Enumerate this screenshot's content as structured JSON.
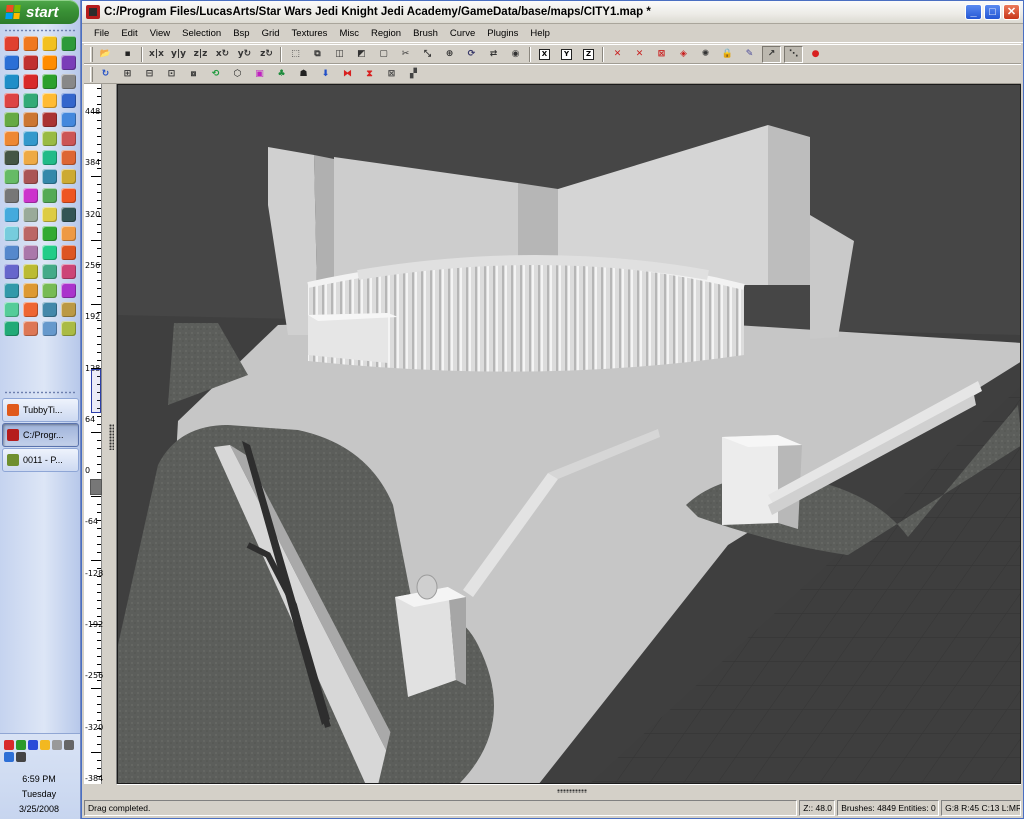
{
  "taskbar": {
    "start_label": "start",
    "quicklaunch_colors": [
      "#e04030",
      "#f07820",
      "#f2c020",
      "#2d9a3a",
      "#2a6fd6",
      "#c03030",
      "#ff8c00",
      "#7a3db8",
      "#1f8ec8",
      "#d82a2a",
      "#2ca02c",
      "#888888",
      "#d44",
      "#3a7",
      "#fb3",
      "#36c",
      "#6a4",
      "#c73",
      "#a33",
      "#48d",
      "#e83",
      "#39c",
      "#9b4",
      "#c55",
      "#454",
      "#ea4",
      "#2b8",
      "#d63",
      "#6b6",
      "#a55",
      "#38a",
      "#ca3",
      "#777",
      "#c3c",
      "#5a5",
      "#e52",
      "#4ad",
      "#9a9",
      "#dc4",
      "#355",
      "#7cd",
      "#b66",
      "#3a3",
      "#e94",
      "#58c",
      "#a7a",
      "#2c8",
      "#d52",
      "#66c",
      "#bb3",
      "#4a8",
      "#c47",
      "#39a",
      "#d93",
      "#7b5",
      "#a3c",
      "#5c9",
      "#e63",
      "#48a",
      "#b94",
      "#2a7",
      "#d75",
      "#69c",
      "#ab4"
    ],
    "tasks": [
      {
        "label": "TubbyTi...",
        "icon_color": "#e05a1c",
        "active": false
      },
      {
        "label": "C:/Progr...",
        "icon_color": "#b51c1c",
        "active": true
      },
      {
        "label": "0011 - P...",
        "icon_color": "#6f8f2f",
        "active": false
      }
    ],
    "tray_icon_colors": [
      "#d82a2a",
      "#2a9a2a",
      "#2a4ad8",
      "#f2b820",
      "#999999",
      "#666666",
      "#2d6fd6",
      "#444444"
    ],
    "clock": {
      "time": "6:59 PM",
      "day": "Tuesday",
      "date": "3/25/2008"
    }
  },
  "window": {
    "title": "C:/Program Files/LucasArts/Star Wars Jedi Knight Jedi Academy/GameData/base/maps/CITY1.map *",
    "caption_buttons": {
      "minimize": "_",
      "maximize": "□",
      "close": "✕"
    }
  },
  "menu": [
    {
      "label": "File"
    },
    {
      "label": "Edit"
    },
    {
      "label": "View"
    },
    {
      "label": "Selection"
    },
    {
      "label": "Bsp"
    },
    {
      "label": "Grid"
    },
    {
      "label": "Textures"
    },
    {
      "label": "Misc"
    },
    {
      "label": "Region"
    },
    {
      "label": "Brush"
    },
    {
      "label": "Curve"
    },
    {
      "label": "Plugins"
    },
    {
      "label": "Help"
    }
  ],
  "toolbar1": [
    {
      "name": "open-icon",
      "glyph": "📂",
      "color": "#c8961e"
    },
    {
      "name": "save-icon",
      "glyph": "▪",
      "color": "#222"
    },
    {
      "sep": true
    },
    {
      "name": "flip-x-icon",
      "glyph": "x|x",
      "color": "#333"
    },
    {
      "name": "flip-y-icon",
      "glyph": "y|y",
      "color": "#333"
    },
    {
      "name": "flip-z-icon",
      "glyph": "z|z",
      "color": "#333"
    },
    {
      "name": "rotate-x-icon",
      "glyph": "x↻",
      "color": "#333"
    },
    {
      "name": "rotate-y-icon",
      "glyph": "y↻",
      "color": "#333"
    },
    {
      "name": "rotate-z-icon",
      "glyph": "z↻",
      "color": "#333"
    },
    {
      "sep": true
    },
    {
      "name": "select-touching-icon",
      "glyph": "⬚",
      "color": "#333"
    },
    {
      "name": "select-inside-icon",
      "glyph": "⧉",
      "color": "#333"
    },
    {
      "name": "csg-subtract-icon",
      "glyph": "◫",
      "color": "#333"
    },
    {
      "name": "csg-merge-icon",
      "glyph": "◩",
      "color": "#333"
    },
    {
      "name": "hollow-icon",
      "glyph": "▢",
      "color": "#333"
    },
    {
      "name": "clipper-icon",
      "glyph": "✂",
      "color": "#333"
    },
    {
      "name": "scale-icon",
      "glyph": "⤡",
      "color": "#333"
    },
    {
      "name": "snap-icon",
      "glyph": "⊕",
      "color": "#333"
    },
    {
      "name": "rotate-tool-icon",
      "glyph": "⟳",
      "color": "#336"
    },
    {
      "name": "change-views-icon",
      "glyph": "⇄",
      "color": "#333"
    },
    {
      "name": "camera-icon",
      "glyph": "◉",
      "color": "#333"
    },
    {
      "sep": true
    },
    {
      "name": "view-x-icon",
      "glyph": "X",
      "color": "#000",
      "boxed": true
    },
    {
      "name": "view-y-icon",
      "glyph": "Y",
      "color": "#000",
      "boxed": true
    },
    {
      "name": "view-z-icon",
      "glyph": "Z",
      "color": "#000",
      "boxed": true
    },
    {
      "sep": true
    },
    {
      "name": "filter-patches-icon",
      "glyph": "✕",
      "color": "#c81e1e"
    },
    {
      "name": "filter-entities-icon",
      "glyph": "✕",
      "color": "#c81e1e"
    },
    {
      "name": "filter-clip-icon",
      "glyph": "⊠",
      "color": "#c81e1e"
    },
    {
      "name": "filter-caulk-icon",
      "glyph": "◈",
      "color": "#c81e1e"
    },
    {
      "name": "lighting-icon",
      "glyph": "✺",
      "color": "#333"
    },
    {
      "name": "texture-lock-icon",
      "glyph": "🔒",
      "color": "#333"
    },
    {
      "name": "patch-tool-icon",
      "glyph": "✎",
      "color": "#4a4a9a"
    },
    {
      "name": "vertex-edit-icon",
      "glyph": "↗",
      "color": "#333",
      "pressed": true
    },
    {
      "name": "edge-edit-icon",
      "glyph": "⋱",
      "color": "#333",
      "pressed": true
    },
    {
      "name": "plugin-icon",
      "glyph": "●",
      "color": "#d82020"
    }
  ],
  "toolbar2": [
    {
      "name": "curve-tool-icon",
      "glyph": "↻",
      "color": "#2250c8"
    },
    {
      "name": "patch-cylinder-icon",
      "glyph": "⊞",
      "color": "#333"
    },
    {
      "name": "patch-dense-icon",
      "glyph": "⊟",
      "color": "#333"
    },
    {
      "name": "patch-bevel-icon",
      "glyph": "⊡",
      "color": "#333"
    },
    {
      "name": "patch-cone-icon",
      "glyph": "⧈",
      "color": "#333"
    },
    {
      "name": "patch-rotate-icon",
      "glyph": "⟲",
      "color": "#1a9a3a"
    },
    {
      "name": "patch-hexagon-icon",
      "glyph": "⬡",
      "color": "#222"
    },
    {
      "name": "patch-texture-icon",
      "glyph": "▣",
      "color": "#c020c0"
    },
    {
      "name": "patch-thicken-icon",
      "glyph": "♣",
      "color": "#1a8a3a"
    },
    {
      "name": "patch-cap-icon",
      "glyph": "☗",
      "color": "#222"
    },
    {
      "name": "patch-invert-icon",
      "glyph": "⬇",
      "color": "#2250c8"
    },
    {
      "name": "patch-mirror-icon",
      "glyph": "⧓",
      "color": "#d82020"
    },
    {
      "name": "patch-split-icon",
      "glyph": "⧗",
      "color": "#d82020"
    },
    {
      "name": "patch-matrix-icon",
      "glyph": "⊠",
      "color": "#444"
    },
    {
      "name": "patch-weld-icon",
      "glyph": "▞",
      "color": "#444"
    }
  ],
  "zruler": {
    "labels": [
      "448",
      "384",
      "320",
      "256",
      "192",
      "128",
      "64",
      "0",
      "-64",
      "-128",
      "-192",
      "-256",
      "-320",
      "-384"
    ]
  },
  "statusbar": {
    "message": "Drag completed.",
    "z": "Z:: 48.0",
    "counts": "Brushes: 4849  Entities: 0",
    "grid": "G:8 R:45 C:13 L:MR"
  }
}
